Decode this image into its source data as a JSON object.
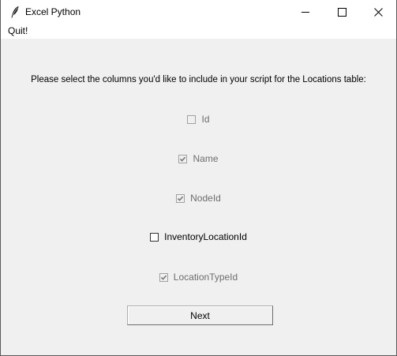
{
  "window": {
    "title": "Excel Python",
    "app_icon": "feather-icon",
    "controls": {
      "minimize_icon": "minimize-icon",
      "maximize_icon": "maximize-icon",
      "close_icon": "close-icon"
    }
  },
  "menubar": {
    "quit_label": "Quit!"
  },
  "main": {
    "prompt": "Please select the columns you'd like to include in your script for the Locations table:",
    "checkboxes": [
      {
        "label": "Id",
        "checked": false,
        "enabled": false
      },
      {
        "label": "Name",
        "checked": true,
        "enabled": false
      },
      {
        "label": "NodeId",
        "checked": true,
        "enabled": false
      },
      {
        "label": "InventoryLocationId",
        "checked": false,
        "enabled": true
      },
      {
        "label": "LocationTypeId",
        "checked": true,
        "enabled": false
      }
    ],
    "next_label": "Next"
  },
  "colors": {
    "background": "#f0f0f0",
    "titlebar": "#ffffff",
    "disabled_text": "#6d6d6d"
  }
}
